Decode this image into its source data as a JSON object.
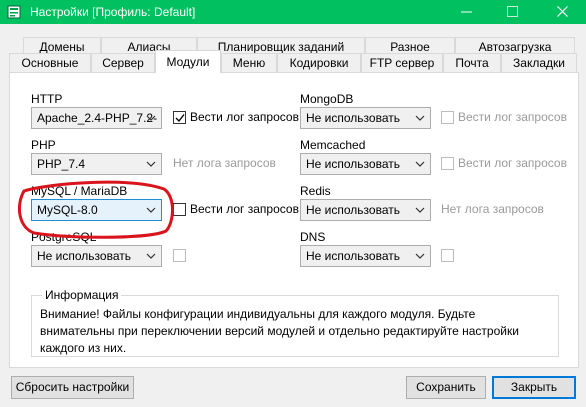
{
  "window": {
    "title": "Настройки [Профиль: Default]",
    "titlebar_color": "#00c060"
  },
  "tabs_row1": [
    "Домены",
    "Алиасы",
    "Планировщик заданий",
    "Разное",
    "Автозагрузка"
  ],
  "tabs_row2": [
    "Основные",
    "Сервер",
    "Модули",
    "Меню",
    "Кодировки",
    "FTP сервер",
    "Почта",
    "Закладки"
  ],
  "active_tab": "Модули",
  "modules": {
    "http": {
      "label": "HTTP",
      "value": "Apache_2.4-PHP_7.2-",
      "log_label": "Вести лог запросов",
      "log_checked": true
    },
    "php": {
      "label": "PHP",
      "value": "PHP_7.4",
      "log_label": "Нет лога запросов"
    },
    "mysql": {
      "label": "MySQL / MariaDB",
      "value": "MySQL-8.0",
      "log_label": "Вести лог запросов",
      "log_checked": false
    },
    "postgresql": {
      "label": "PostgreSQL",
      "value": "Не использовать"
    },
    "mongodb": {
      "label": "MongoDB",
      "value": "Не использовать",
      "log_label": "Вести лог запросов"
    },
    "memcached": {
      "label": "Memcached",
      "value": "Не использовать",
      "log_label": "Вести лог запросов"
    },
    "redis": {
      "label": "Redis",
      "value": "Не использовать",
      "log_label": "Нет лога запросов"
    },
    "dns": {
      "label": "DNS",
      "value": "Не использовать"
    }
  },
  "info": {
    "title": "Информация",
    "text": "Внимание! Файлы конфигурации индивидуальны для каждого модуля. Будьте внимательны при переключении версий модулей и отдельно редактируйте настройки каждого из них."
  },
  "buttons": {
    "reset": "Сбросить настройки",
    "save": "Сохранить",
    "close": "Закрыть"
  },
  "colors": {
    "annotation": "#d9141c",
    "accent": "#0078d7"
  }
}
